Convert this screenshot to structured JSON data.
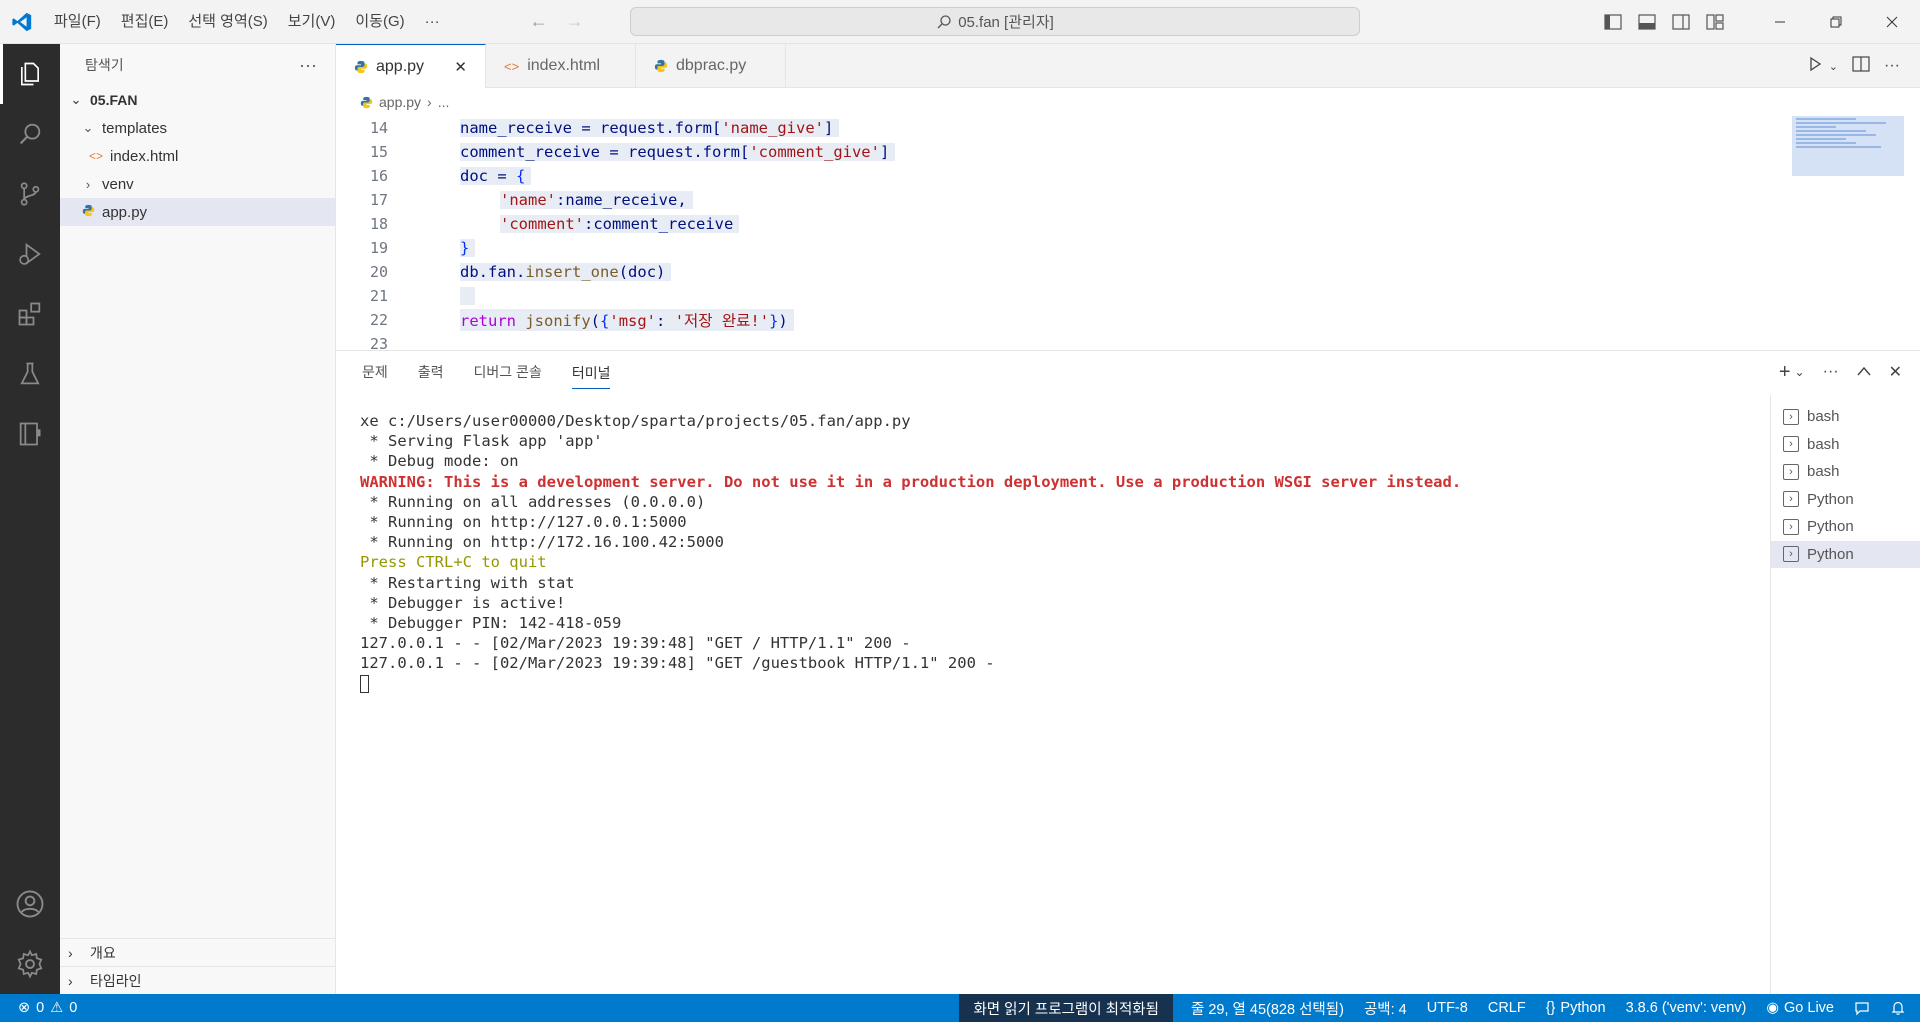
{
  "menu": [
    "파일(F)",
    "편집(E)",
    "선택 영역(S)",
    "보기(V)",
    "이동(G)",
    "···"
  ],
  "search": {
    "text": "05.fan [관리자]"
  },
  "sidebar": {
    "title": "탐색기",
    "root": "05.FAN",
    "tree": [
      {
        "label": "templates",
        "type": "folder-open",
        "indent": 1
      },
      {
        "label": "index.html",
        "type": "html",
        "indent": 2
      },
      {
        "label": "venv",
        "type": "folder-closed",
        "indent": 1
      },
      {
        "label": "app.py",
        "type": "python",
        "indent": 1
      }
    ],
    "outline": "개요",
    "timeline": "타임라인"
  },
  "tabs": [
    {
      "label": "app.py",
      "icon": "python-icon"
    },
    {
      "label": "index.html",
      "icon": "html-icon"
    },
    {
      "label": "dbprac.py",
      "icon": "python-icon"
    }
  ],
  "breadcrumb": {
    "file": "app.py",
    "more": "..."
  },
  "code_lines": [
    {
      "num": "14",
      "text": "name_receive = request.form['name_give']"
    },
    {
      "num": "15",
      "text": "comment_receive = request.form['comment_give']"
    },
    {
      "num": "16",
      "text": "doc = {"
    },
    {
      "num": "17",
      "text": "'name':name_receive,"
    },
    {
      "num": "18",
      "text": "'comment':comment_receive"
    },
    {
      "num": "19",
      "text": "}"
    },
    {
      "num": "20",
      "text": "db.fan.insert_one(doc)"
    },
    {
      "num": "21",
      "text": ""
    },
    {
      "num": "22",
      "text": "return jsonify({'msg': '저장 완료!'})"
    },
    {
      "num": "23",
      "text": ""
    }
  ],
  "panel_tabs": [
    "문제",
    "출력",
    "디버그 콘솔",
    "터미널"
  ],
  "terminal": {
    "l1": "xe c:/Users/user00000/Desktop/sparta/projects/05.fan/app.py",
    "l2": " * Serving Flask app 'app'",
    "l3": " * Debug mode: on",
    "l4": "WARNING: This is a development server. Do not use it in a production deployment. Use a production WSGI server instead.",
    "l5": " * Running on all addresses (0.0.0.0)",
    "l6": " * Running on http://127.0.0.1:5000",
    "l7": " * Running on http://172.16.100.42:5000",
    "l8": "Press CTRL+C to quit",
    "l9": " * Restarting with stat",
    "l10": " * Debugger is active!",
    "l11": " * Debugger PIN: 142-418-059",
    "l12": "127.0.0.1 - - [02/Mar/2023 19:39:48] \"GET / HTTP/1.1\" 200 -",
    "l13": "127.0.0.1 - - [02/Mar/2023 19:39:48] \"GET /guestbook HTTP/1.1\" 200 -"
  },
  "terminals": [
    "bash",
    "bash",
    "bash",
    "Python",
    "Python",
    "Python"
  ],
  "status": {
    "errors": "0",
    "warnings": "0",
    "screen_reader": "화면 읽기 프로그램이 최적화됨",
    "position": "줄 29, 열 45(828 선택됨)",
    "spaces": "공백: 4",
    "encoding": "UTF-8",
    "eol": "CRLF",
    "language": "Python",
    "interpreter": "3.8.6 ('venv': venv)",
    "golive": "Go Live"
  },
  "colors": {
    "accent": "#007acc",
    "activitybar": "#2c2c2c",
    "warning": "#cd3131"
  }
}
